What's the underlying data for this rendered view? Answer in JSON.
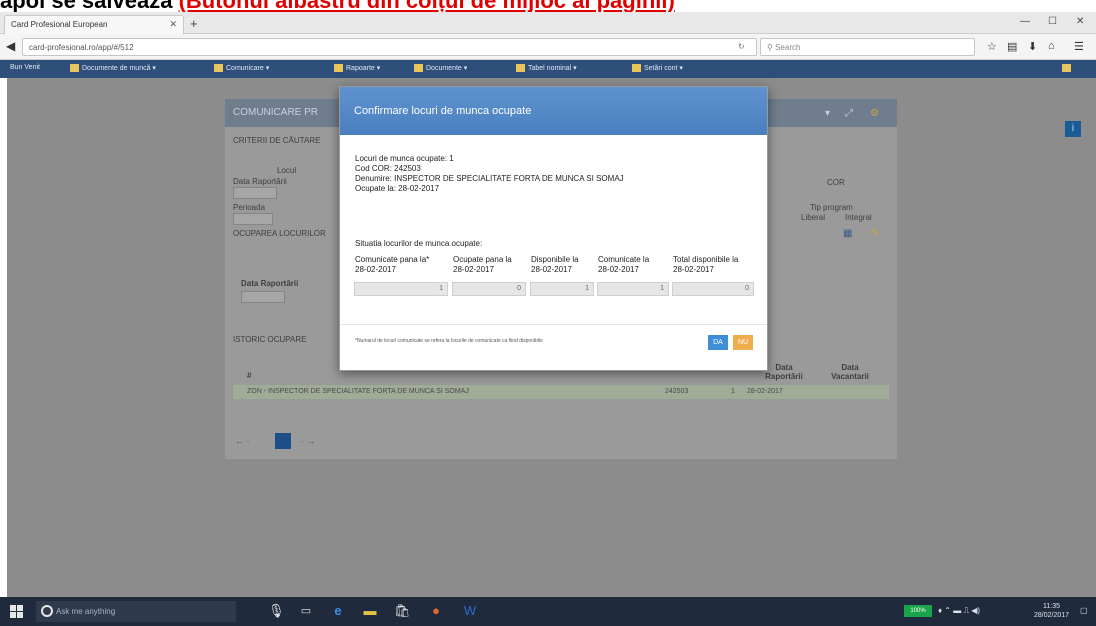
{
  "caption": {
    "text_black": "apoi se salvează",
    "text_red": "(Butonul albastru din colțul de mijloc al paginii)"
  },
  "browser": {
    "tab_title": "Card Profesional European",
    "url": "card-profesional.ro/app/#/512",
    "search_placeholder": "Search"
  },
  "bookmarks": [
    "Bun Venit",
    "Documente de muncă",
    "Comunicare",
    "Rapoarte",
    "Documente",
    "Tabel nominal",
    "Setări cont"
  ],
  "page": {
    "panel_title": "COMUNICARE PR",
    "section_criteria": "CRITERII DE CĂUTARE",
    "label_locul": "Locul",
    "label_data_raportarii": "Data Raportării",
    "label_perioada": "Perioada",
    "label_cor": "COR",
    "label_tip_program": "Tip program",
    "label_liberal": "Liberal",
    "label_integral": "Integral",
    "section_ocuparea": "OCUPAREA LOCURILOR",
    "label_data_raportarii_2": "Data Raportării",
    "section_istoric": "ISTORIC OCUPARE",
    "col_hash": "#",
    "col_data_raportarii": "Data Raportării",
    "col_data_vacantarii": "Data Vacantarii",
    "row_text": "ZON - INSPECTOR DE SPECIALITATE FORTA DE MUNCA SI SOMAJ",
    "row_code": "242503",
    "row_count": "1",
    "row_date": "28-02-2017",
    "info_icon": "i"
  },
  "modal": {
    "title": "Confirmare locuri de munca ocupate",
    "info_lines": [
      "Locuri de munca ocupate: 1",
      "Cod COR: 242503",
      "Denumire: INSPECTOR DE SPECIALITATE FORTA DE MUNCA SI SOMAJ",
      "Ocupate la: 28-02-2017"
    ],
    "subtitle": "Situatia locurilor de munca ocupate:",
    "columns": [
      {
        "line1": "Comunicate pana la*",
        "line2": "28-02-2017",
        "value": "1"
      },
      {
        "line1": "Ocupate pana la",
        "line2": "28-02-2017",
        "value": "0"
      },
      {
        "line1": "Disponibile la",
        "line2": "28-02-2017",
        "value": "1"
      },
      {
        "line1": "Comunicate la",
        "line2": "28-02-2017",
        "value": "1"
      },
      {
        "line1": "Total disponibile la",
        "line2": "28-02-2017",
        "value": "0"
      }
    ],
    "footnote": "*Numarul de locuri comunicate se refera la locurile de comunicate ca fiind disponibile",
    "btn_da": "DA",
    "btn_nu": "NU"
  },
  "taskbar": {
    "search_placeholder": "Ask me anything",
    "battery": "100%",
    "time": "11:35",
    "date": "28/02/2017"
  },
  "colors": {
    "modal_header": "#4a7fc0",
    "btn_da": "#3e8fd8",
    "btn_nu": "#f0ad4e",
    "caption_red": "#e00000"
  }
}
